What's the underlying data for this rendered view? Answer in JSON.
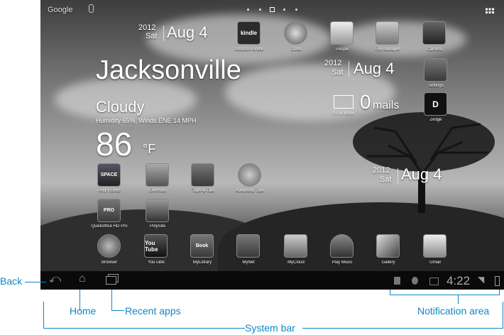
{
  "search": {
    "logo": "Google",
    "mic_icon": "microphone-icon"
  },
  "page_dots": {
    "count": 5,
    "active": 2
  },
  "grid_icon": "apps-grid-icon",
  "date_widget_top": {
    "year": "2012",
    "day": "Sat",
    "date": "Aug 4"
  },
  "weather": {
    "city": "Jacksonville",
    "condition": "Cloudy",
    "details": "Humidity 65%, Winds ENE 14 MPH",
    "temp": "86",
    "unit": "°F"
  },
  "date_widget_right": {
    "year": "2012",
    "day": "Sat",
    "date": "Aug 4"
  },
  "date_widget_lower": {
    "year": "2012",
    "day": "Sat",
    "date": "Aug 4"
  },
  "mail_widget": {
    "count": "0",
    "label": "mails",
    "sub": "Go to Inbox"
  },
  "top_apps": [
    {
      "label": "Amazon Kindle",
      "glyph": "kindle"
    },
    {
      "label": "Clock",
      "glyph": ""
    },
    {
      "label": "People",
      "glyph": ""
    },
    {
      "label": "File Manager",
      "glyph": ""
    },
    {
      "label": "Camera",
      "glyph": ""
    }
  ],
  "side_apps": [
    {
      "label": "Settings",
      "glyph": ""
    },
    {
      "label": "Zedge",
      "glyph": "D"
    }
  ],
  "mid_apps": [
    {
      "label": "Angry Birds",
      "glyph": "SPACE"
    },
    {
      "label": "Evernote",
      "glyph": ""
    },
    {
      "label": "Tape-a-Talk",
      "glyph": ""
    },
    {
      "label": "Advanced Task",
      "glyph": ""
    }
  ],
  "mid_apps2": [
    {
      "label": "Quickoffice HD Pro",
      "glyph": "PRO"
    },
    {
      "label": "PolySite",
      "glyph": ""
    }
  ],
  "dock_apps": [
    {
      "label": "Browser",
      "glyph": ""
    },
    {
      "label": "YouTube",
      "glyph": "You Tube"
    },
    {
      "label": "MyLibrary",
      "glyph": "Book"
    },
    {
      "label": "MyNet",
      "glyph": ""
    },
    {
      "label": "MyCloud",
      "glyph": ""
    },
    {
      "label": "Play Music",
      "glyph": ""
    },
    {
      "label": "Gallery",
      "glyph": ""
    },
    {
      "label": "Gmail",
      "glyph": ""
    }
  ],
  "status": {
    "time": "4:22"
  },
  "callouts": {
    "back": "Back",
    "home": "Home",
    "recent": "Recent apps",
    "notification": "Notification area",
    "system_bar": "System bar"
  }
}
